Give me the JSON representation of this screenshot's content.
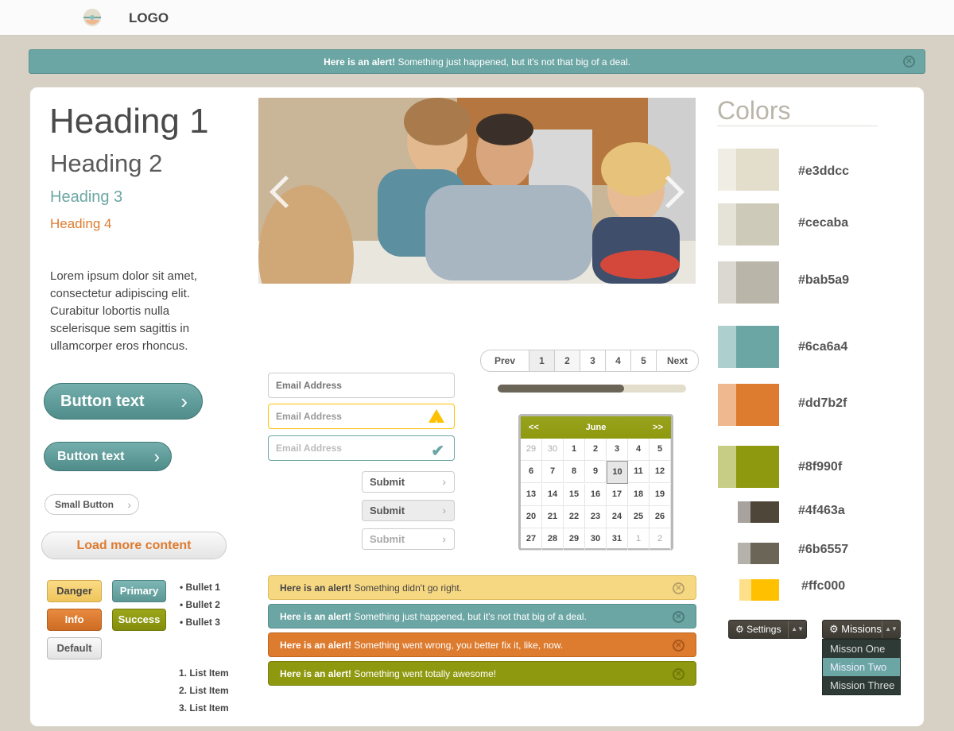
{
  "header": {
    "logo_text": "LOGO"
  },
  "top_alert": {
    "strong": "Here is an alert!",
    "text": " Something just happened, but it's not that big of a deal.",
    "close": "✕"
  },
  "typography": {
    "h1": "Heading 1",
    "h2": "Heading 2",
    "h3": "Heading 3",
    "h4": "Heading 4",
    "paragraph": "Lorem ipsum dolor sit amet, consectetur adipiscing elit. Curabitur lobortis nulla scelerisque sem sagittis in ullamcorper eros rhoncus."
  },
  "buttons": {
    "large": "Button text",
    "medium": "Button text",
    "small": "Small Button",
    "load_more": "Load more content",
    "chevron": "›"
  },
  "tags": {
    "danger": "Danger",
    "primary": "Primary",
    "info": "Info",
    "success": "Success",
    "default": "Default"
  },
  "bullets": [
    "• Bullet 1",
    "• Bullet 2",
    "• Bullet 3"
  ],
  "ordered_list": [
    "1. List Item",
    "2. List Item",
    "3. List Item"
  ],
  "carousel": {
    "prev_icon": "chevron-left-icon",
    "next_icon": "chevron-right-icon"
  },
  "pagination": {
    "prev": "Prev",
    "pages": [
      "1",
      "2",
      "3",
      "4",
      "5"
    ],
    "next": "Next",
    "current": "2"
  },
  "progress": {
    "value": 0.67
  },
  "form": {
    "email_placeholder": "Email Address",
    "warn_icon_text": "!",
    "ok_icon_text": "✔",
    "submit": "Submit"
  },
  "calendar": {
    "month": "June",
    "prev": "<<",
    "next": ">>",
    "days": [
      [
        "29",
        "30",
        "1",
        "2",
        "3",
        "4",
        "5"
      ],
      [
        "6",
        "7",
        "8",
        "9",
        "10",
        "11",
        "12"
      ],
      [
        "13",
        "14",
        "15",
        "16",
        "17",
        "18",
        "19"
      ],
      [
        "20",
        "21",
        "22",
        "23",
        "24",
        "25",
        "26"
      ],
      [
        "27",
        "28",
        "29",
        "30",
        "31",
        "1",
        "2"
      ]
    ],
    "selected": "10"
  },
  "alerts": [
    {
      "strong": "Here is an alert!",
      "text": " Something didn't go right.",
      "bg": "#f7d882",
      "border": "#dfbd5c",
      "color": "#444",
      "x": "#b9a267"
    },
    {
      "strong": "Here is an alert!",
      "text": " Something just happened, but it's not that big of a deal.",
      "bg": "#6ca6a4",
      "border": "#568f8d",
      "color": "#fff",
      "x": "#4a7c7a"
    },
    {
      "strong": "Here is an alert!",
      "text": " Something went wrong, you better fix it, like, now.",
      "bg": "#dd7b2f",
      "border": "#c0661f",
      "color": "#fff",
      "x": "#a8571a"
    },
    {
      "strong": "Here is an alert!",
      "text": " Something went totally awesome!",
      "bg": "#8f990f",
      "border": "#77800a",
      "color": "#fff",
      "x": "#6e7608"
    }
  ],
  "close_glyph": "✕",
  "colors": {
    "title": "Colors",
    "swatches": [
      {
        "hex": "#e3ddcc",
        "light": "#f0ede4"
      },
      {
        "hex": "#cecaba",
        "light": "#e5e2d8"
      },
      {
        "hex": "#bab5a9",
        "light": "#dbd8d2"
      },
      {
        "hex": "#6ca6a4",
        "light": "#add0cf"
      },
      {
        "hex": "#dd7b2f",
        "light": "#efb88f"
      },
      {
        "hex": "#8f990f",
        "light": "#c7cd85"
      },
      {
        "hex": "#4f463a",
        "light": "#a7a29d"
      },
      {
        "hex": "#6b6557",
        "light": "#b5b2ab"
      },
      {
        "hex": "#ffc000",
        "light": "#ffe08a"
      }
    ]
  },
  "dropdowns": {
    "settings": "⚙ Settings",
    "missions": "⚙ Missions",
    "caret": "▲▼",
    "mission_items": [
      "Misson One",
      "Mission Two",
      "Mission Three"
    ],
    "active_item": "Mission Two"
  }
}
